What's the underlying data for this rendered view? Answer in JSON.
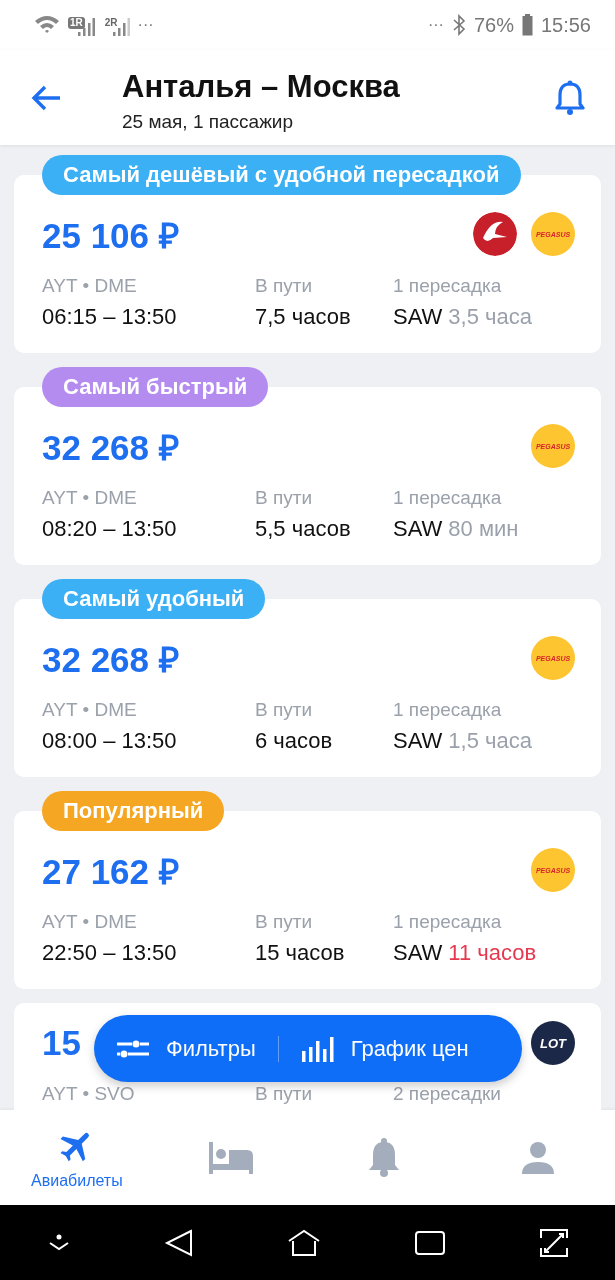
{
  "status_bar": {
    "sim_labels": [
      "1R",
      "2R"
    ],
    "left_more": "···",
    "right_more": "···",
    "battery": "76%",
    "time": "15:56"
  },
  "header": {
    "title": "Анталья – Москва",
    "subtitle": "25 мая, 1 пассажир"
  },
  "offers": [
    {
      "badge": "Самый дешёвый с удобной пересадкой",
      "color": "#3bb0f5",
      "price": "25 106 ₽",
      "airlines": [
        {
          "kind": "turkish"
        },
        {
          "kind": "pegasus",
          "label": "PEGASUS"
        }
      ],
      "route": "AYT • DME",
      "times": "06:15 – 13:50",
      "duration_label": "В пути",
      "duration": "7,5 часов",
      "stops": "1 пересадка",
      "via": "SAW",
      "layover": "3,5 часа",
      "long_layover": false
    },
    {
      "badge": "Самый быстрый",
      "color": "#b48cf0",
      "price": "32 268 ₽",
      "airlines": [
        {
          "kind": "pegasus",
          "label": "PEGASUS"
        }
      ],
      "route": "AYT • DME",
      "times": "08:20 – 13:50",
      "duration_label": "В пути",
      "duration": "5,5 часов",
      "stops": "1 пересадка",
      "via": "SAW",
      "layover": "80 мин",
      "long_layover": false
    },
    {
      "badge": "Самый удобный",
      "color": "#3bb0f5",
      "price": "32 268 ₽",
      "airlines": [
        {
          "kind": "pegasus",
          "label": "PEGASUS"
        }
      ],
      "route": "AYT • DME",
      "times": "08:00 – 13:50",
      "duration_label": "В пути",
      "duration": "6 часов",
      "stops": "1 пересадка",
      "via": "SAW",
      "layover": "1,5 часа",
      "long_layover": false
    },
    {
      "badge": "Популярный",
      "color": "#f5a623",
      "price": "27 162 ₽",
      "airlines": [
        {
          "kind": "pegasus",
          "label": "PEGASUS"
        }
      ],
      "route": "AYT • DME",
      "times": "22:50 – 13:50",
      "duration_label": "В пути",
      "duration": "15 часов",
      "stops": "1 пересадка",
      "via": "SAW",
      "layover": "11 часов",
      "long_layover": true
    },
    {
      "price": "15",
      "airlines": [
        {
          "kind": "lot",
          "label": "LOT"
        }
      ],
      "route": "AYT • SVO",
      "duration_label": "В пути",
      "stops": "2 пересадки"
    }
  ],
  "floating_bar": {
    "filters": "Фильтры",
    "chart": "График цен"
  },
  "bottom_nav": [
    {
      "kind": "flights",
      "label": "Авиабилеты",
      "selected": true
    },
    {
      "kind": "hotels",
      "selected": false
    },
    {
      "kind": "alerts",
      "selected": false
    },
    {
      "kind": "profile",
      "selected": false
    }
  ]
}
